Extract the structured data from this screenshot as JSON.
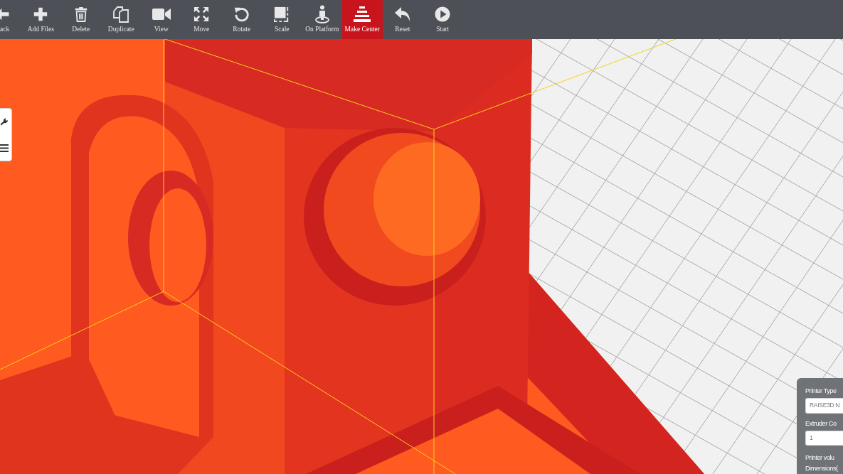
{
  "toolbar": {
    "items": [
      {
        "label": "ack",
        "selected": false
      },
      {
        "label": "Add Files",
        "selected": false
      },
      {
        "label": "Delete",
        "selected": false
      },
      {
        "label": "Duplicate",
        "selected": false
      },
      {
        "label": "View",
        "selected": false
      },
      {
        "label": "Move",
        "selected": false
      },
      {
        "label": "Rotate",
        "selected": false
      },
      {
        "label": "Scale",
        "selected": false
      },
      {
        "label": "On Platform",
        "selected": false
      },
      {
        "label": "Make Center",
        "selected": true
      },
      {
        "label": "Reset",
        "selected": false
      },
      {
        "label": "Start",
        "selected": false
      }
    ]
  },
  "printer_panel": {
    "fields": [
      {
        "label": "Printer Type",
        "value": "RAISE3D N"
      },
      {
        "label": "Extruder Co",
        "value": "1"
      }
    ],
    "notes": [
      "Printer volu",
      "Dimensions("
    ]
  }
}
